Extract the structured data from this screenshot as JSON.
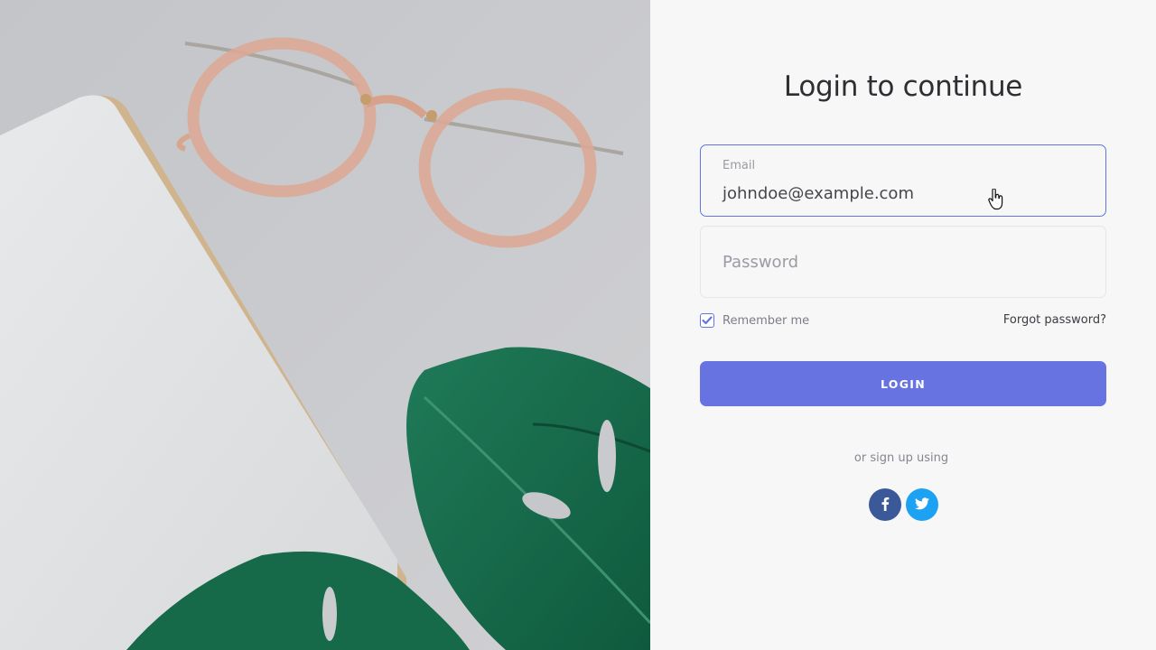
{
  "hero": {
    "image": "flat-lay-glasses-notebook-monstera-leaves"
  },
  "login": {
    "title": "Login to continue",
    "email": {
      "label": "Email",
      "value": "johndoe@example.com"
    },
    "password": {
      "placeholder": "Password",
      "value": ""
    },
    "remember": {
      "label": "Remember me",
      "checked": true
    },
    "forgot_label": "Forgot password?",
    "submit_label": "LOGIN",
    "signup_text": "or sign up using",
    "social": [
      {
        "name": "facebook",
        "icon": "facebook-icon",
        "color": "#3b5998"
      },
      {
        "name": "twitter",
        "icon": "twitter-icon",
        "color": "#1da1f2"
      }
    ]
  },
  "colors": {
    "accent": "#6673e0",
    "panel_bg": "#f7f7f8",
    "active_border": "#6574e0"
  }
}
